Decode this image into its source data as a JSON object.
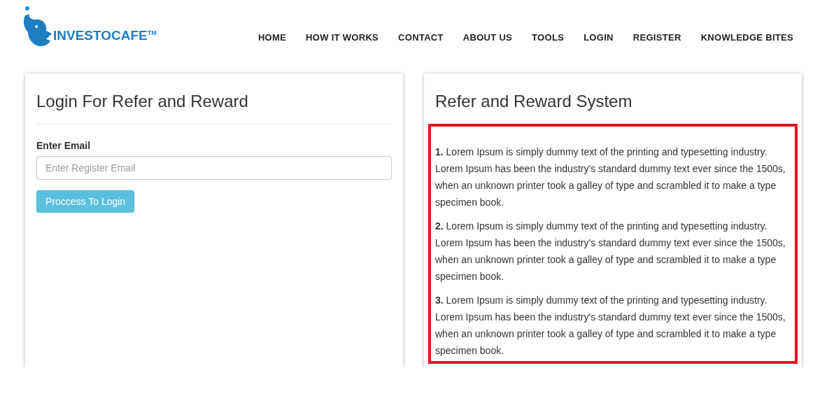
{
  "logo": {
    "text": "INVESTOCAFE$^{TM}$"
  },
  "nav": [
    {
      "label": "HOME"
    },
    {
      "label": "HOW IT WORKS"
    },
    {
      "label": "CONTACT"
    },
    {
      "label": "ABOUT US"
    },
    {
      "label": "TOOLS"
    },
    {
      "label": "LOGIN"
    },
    {
      "label": "REGISTER"
    },
    {
      "label": "KNOWLEDGE BITES"
    }
  ],
  "login_card": {
    "title": "Login For Refer and Reward",
    "field_label": "Enter Email",
    "placeholder": "Enter Register Email",
    "button": "Proccess To Login"
  },
  "info_card": {
    "title": "Refer and Reward System",
    "highlighted": true,
    "paragraphs": [
      "**1.** Lorem Ipsum is simply dummy text of the printing and typesetting industry. Lorem Ipsum has been the industry's standard dummy text ever since the 1500s, when an unknown printer took a galley of type and scrambled it to make a type specimen book.",
      "**2.** Lorem Ipsum is simply dummy text of the printing and typesetting industry. Lorem Ipsum has been the industry's standard dummy text ever since the 1500s, when an unknown printer took a galley of type and scrambled it to make a type specimen book.",
      "**3.** Lorem Ipsum is simply dummy text of the printing and typesetting industry. Lorem Ipsum has been the industry's standard dummy text ever since the 1500s, when an unknown printer took a galley of type and scrambled it to make a type specimen book."
    ]
  }
}
